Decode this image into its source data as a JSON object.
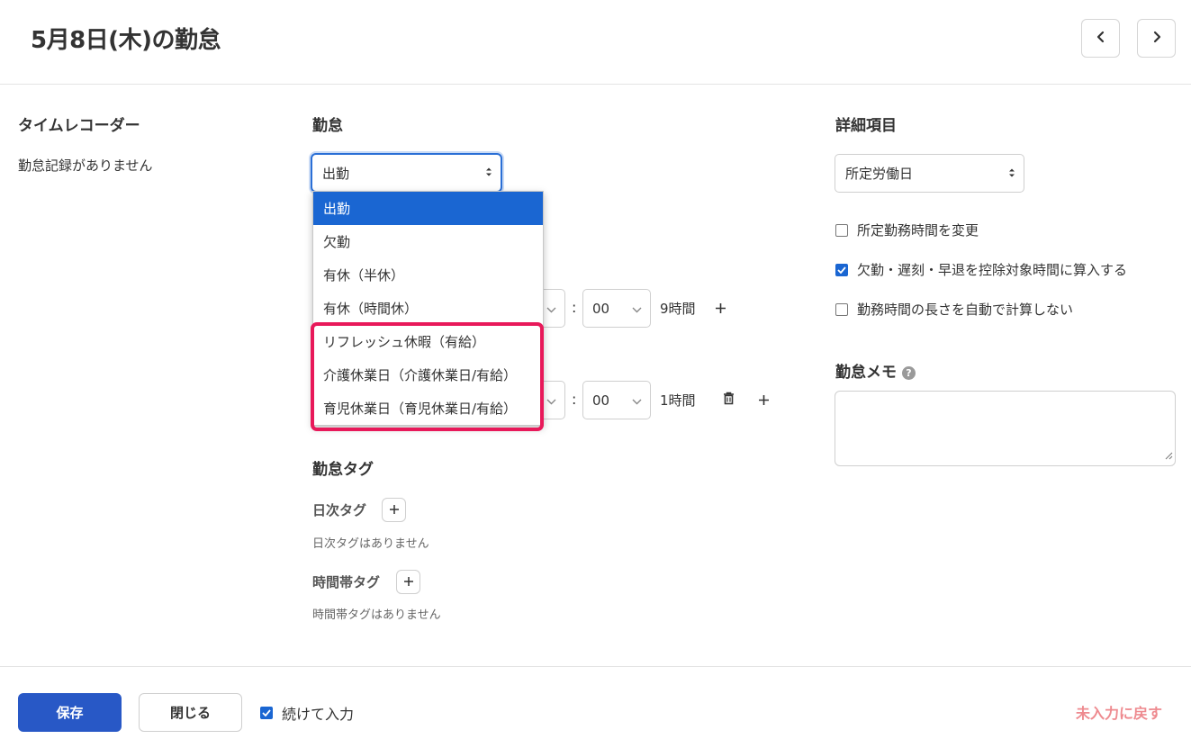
{
  "header": {
    "title": "5月8日(木)の勤怠",
    "prev_icon": "chevron-left-icon",
    "next_icon": "chevron-right-icon"
  },
  "timerecorder": {
    "heading": "タイムレコーダー",
    "empty_text": "勤怠記録がありません"
  },
  "attendance": {
    "heading": "勤怠",
    "type_select": {
      "value": "出勤",
      "options": [
        "出勤",
        "欠勤",
        "有休（半休）",
        "有休（時間休）",
        "リフレッシュ休暇（有給）",
        "介護休業日（介護休業日/有給）",
        "育児休業日（育児休業日/有給）"
      ],
      "highlight_color": "#e8195a"
    },
    "rows": [
      {
        "minute": "00",
        "duration": "9時間"
      },
      {
        "minute": "00",
        "duration": "1時間"
      }
    ]
  },
  "tags": {
    "heading": "勤怠タグ",
    "daily_label": "日次タグ",
    "daily_empty": "日次タグはありません",
    "timeband_label": "時間帯タグ",
    "timeband_empty": "時間帯タグはありません"
  },
  "details": {
    "heading": "詳細項目",
    "select_value": "所定労働日",
    "checkboxes": [
      {
        "label": "所定勤務時間を変更",
        "checked": false
      },
      {
        "label": "欠勤・遅刻・早退を控除対象時間に算入する",
        "checked": true
      },
      {
        "label": "勤務時間の長さを自動で計算しない",
        "checked": false
      }
    ],
    "memo_heading": "勤怠メモ",
    "memo_help": "?"
  },
  "footer": {
    "save_label": "保存",
    "close_label": "閉じる",
    "continue_label": "続けて入力",
    "continue_checked": true,
    "reset_label": "未入力に戻す"
  },
  "colors": {
    "primary": "#2858c6",
    "selected_option": "#1a66d2",
    "reset_link": "#ee8a8f"
  }
}
